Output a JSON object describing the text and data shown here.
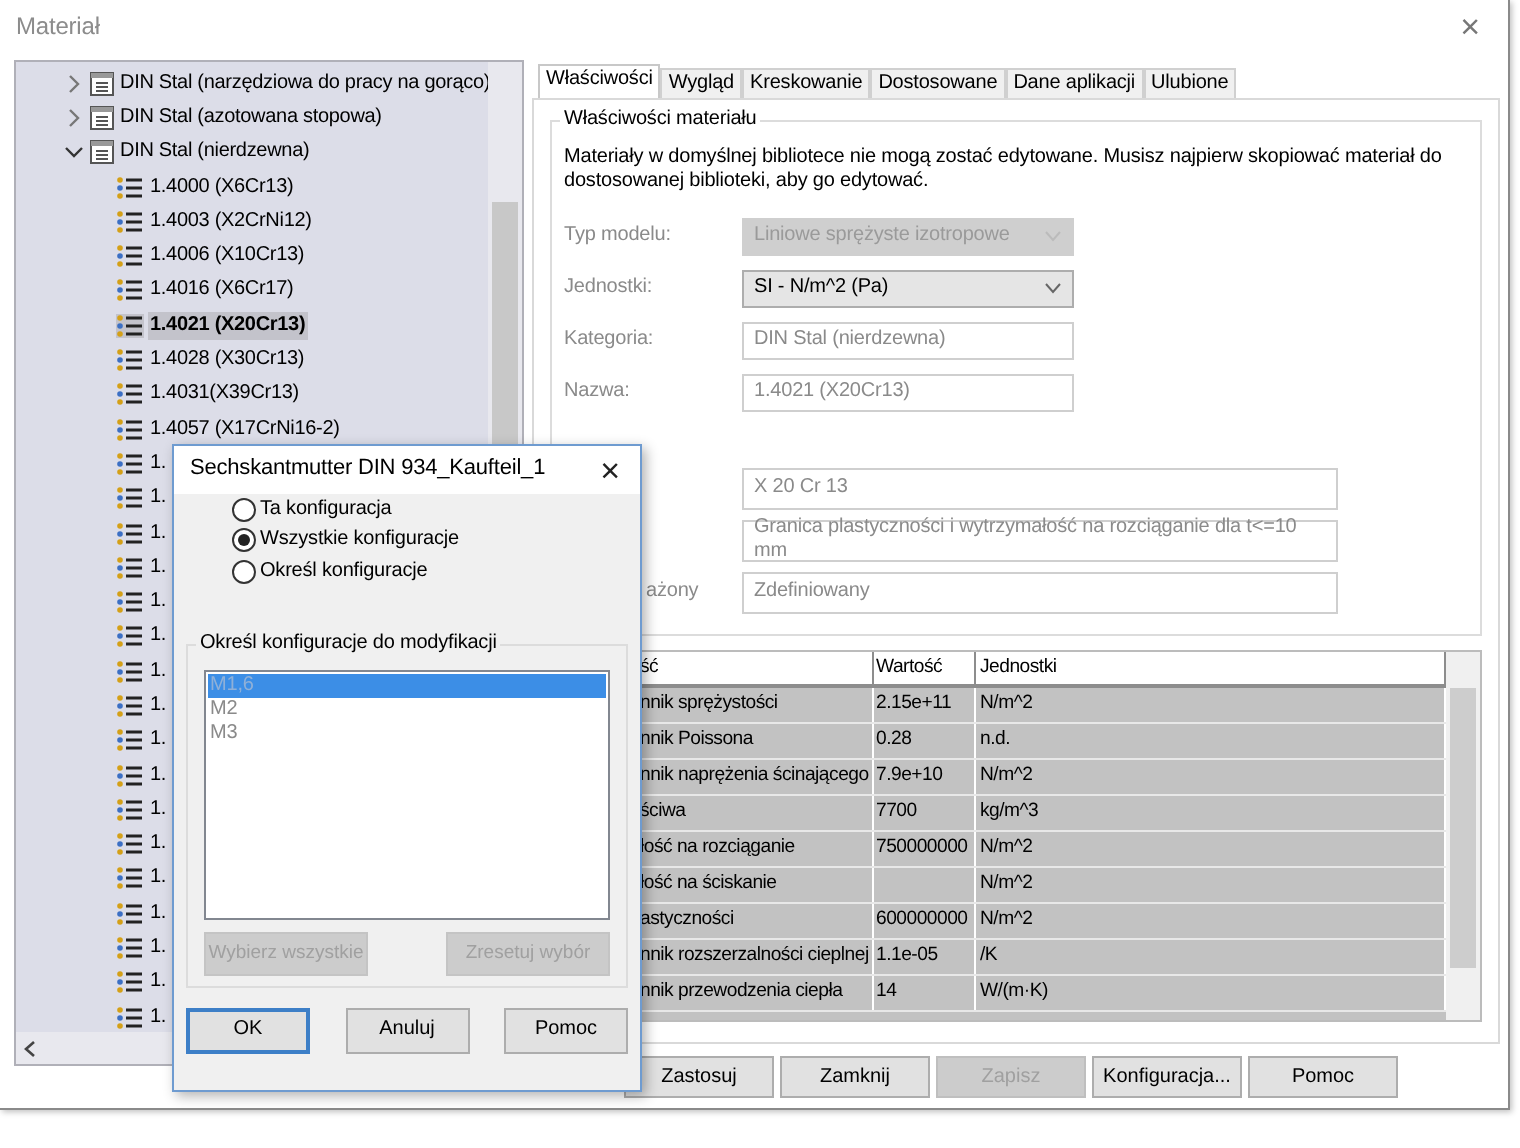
{
  "window": {
    "title": "Materiał",
    "close": "×"
  },
  "tree": {
    "items": [
      {
        "kind": "folder",
        "label": "DIN Stal (narzędziowa do pracy na gorąco)",
        "expanded": false,
        "selected": false
      },
      {
        "kind": "folder",
        "label": "DIN Stal (azotowana stopowa)",
        "expanded": false,
        "selected": false
      },
      {
        "kind": "folder",
        "label": "DIN Stal (nierdzewna)",
        "expanded": true,
        "selected": false,
        "children": [
          {
            "kind": "material",
            "label": "1.4000 (X6Cr13)",
            "selected": false
          },
          {
            "kind": "material",
            "label": "1.4003 (X2CrNi12)",
            "selected": false
          },
          {
            "kind": "material",
            "label": "1.4006 (X10Cr13)",
            "selected": false
          },
          {
            "kind": "material",
            "label": "1.4016 (X6Cr17)",
            "selected": false
          },
          {
            "kind": "material",
            "label": "1.4021 (X20Cr13)",
            "selected": true
          },
          {
            "kind": "material",
            "label": "1.4028 (X30Cr13)",
            "selected": false
          },
          {
            "kind": "material",
            "label": "1.4031(X39Cr13)",
            "selected": false
          },
          {
            "kind": "material",
            "label": "1.4057 (X17CrNi16-2)",
            "selected": false
          },
          {
            "kind": "material",
            "label": "1.",
            "selected": false
          },
          {
            "kind": "material",
            "label": "1.",
            "selected": false
          },
          {
            "kind": "material",
            "label": "1.",
            "selected": false
          },
          {
            "kind": "material",
            "label": "1.",
            "selected": false
          },
          {
            "kind": "material",
            "label": "1.",
            "selected": false
          },
          {
            "kind": "material",
            "label": "1.",
            "selected": false
          },
          {
            "kind": "material",
            "label": "1.",
            "selected": false
          },
          {
            "kind": "material",
            "label": "1.",
            "selected": false
          },
          {
            "kind": "material",
            "label": "1.",
            "selected": false
          },
          {
            "kind": "material",
            "label": "1.",
            "selected": false
          },
          {
            "kind": "material",
            "label": "1.",
            "selected": false
          },
          {
            "kind": "material",
            "label": "1.",
            "selected": false
          },
          {
            "kind": "material",
            "label": "1.",
            "selected": false
          },
          {
            "kind": "material",
            "label": "1.",
            "selected": false
          },
          {
            "kind": "material",
            "label": "1.",
            "selected": false
          },
          {
            "kind": "material",
            "label": "1.",
            "selected": false
          },
          {
            "kind": "material",
            "label": "1.",
            "selected": false
          }
        ]
      }
    ]
  },
  "tabs": [
    {
      "label": "Właściwości",
      "selected": true
    },
    {
      "label": "Wygląd",
      "selected": false
    },
    {
      "label": "Kreskowanie",
      "selected": false
    },
    {
      "label": "Dostosowane",
      "selected": false
    },
    {
      "label": "Dane aplikacji",
      "selected": false
    },
    {
      "label": "Ulubione",
      "selected": false
    }
  ],
  "properties": {
    "title": "Właściwości materiału",
    "note": "Materiały w domyślnej bibliotece nie mogą zostać edytowane. Musisz najpierw skopiować materiał do dostosowanej biblioteki, aby go edytować.",
    "fields": [
      {
        "kind": "select",
        "label": "Typ modelu:",
        "value": "Liniowe sprężyste izotropowe",
        "disabled": true
      },
      {
        "kind": "select",
        "label": "Jednostki:",
        "value": "SI - N/m^2 (Pa)",
        "disabled": false
      },
      {
        "kind": "text",
        "label": "Kategoria:",
        "value": "DIN Stal (nierdzewna)"
      },
      {
        "kind": "text",
        "label": "Nazwa:",
        "value": "1.4021 (X20Cr13)"
      }
    ],
    "extra_fields": [
      {
        "kind": "wide",
        "value": "X 20 Cr 13"
      },
      {
        "kind": "wide",
        "value": "Granica plastyczności i wytrzymałość na rozciąganie dla t<=10 mm"
      },
      {
        "kind": "wide",
        "label": "ażony",
        "value": "Zdefiniowany"
      }
    ]
  },
  "table": {
    "columns": [
      "ść",
      "Wartość",
      "Jednostki"
    ],
    "rows": [
      [
        "nnik sprężystości",
        "2.15e+11",
        "N/m^2"
      ],
      [
        "nnik Poissona",
        "0.28",
        "n.d."
      ],
      [
        "nnik naprężenia ścinającego",
        "7.9e+10",
        "N/m^2"
      ],
      [
        "ściwa",
        "7700",
        "kg/m^3"
      ],
      [
        "łość na rozciąganie",
        "750000000",
        "N/m^2"
      ],
      [
        "łość na ściskanie",
        null,
        "N/m^2"
      ],
      [
        "astyczności",
        "600000000",
        "N/m^2"
      ],
      [
        "nnik rozszerzalności cieplnej",
        "1.1e-05",
        "/K"
      ],
      [
        "nnik przewodzenia ciepła",
        "14",
        "W/(m·K)"
      ]
    ]
  },
  "buttons": [
    {
      "label": "Zastosuj",
      "disabled": false
    },
    {
      "label": "Zamknij",
      "disabled": false
    },
    {
      "label": "Zapisz",
      "disabled": true
    },
    {
      "label": "Konfiguracja...",
      "disabled": false
    },
    {
      "label": "Pomoc",
      "disabled": false
    }
  ],
  "dialog": {
    "title": "Sechskantmutter DIN 934_Kaufteil_1",
    "close": "×",
    "options": [
      {
        "label": "Ta konfiguracja",
        "selected": false
      },
      {
        "label": "Wszystkie konfiguracje",
        "selected": true
      },
      {
        "label": "Określ konfiguracje",
        "selected": false
      }
    ],
    "group_title": "Określ konfiguracje do modyfikacji",
    "configurations": [
      {
        "label": "M1,6",
        "selected": true
      },
      {
        "label": "M2",
        "selected": false
      },
      {
        "label": "M3",
        "selected": false
      }
    ],
    "list_buttons": [
      {
        "label": "Wybierz wszystkie",
        "disabled": true
      },
      {
        "label": "Zresetuj wybór",
        "disabled": true
      }
    ],
    "buttons": [
      {
        "label": "OK",
        "default": true
      },
      {
        "label": "Anuluj",
        "default": false
      },
      {
        "label": "Pomoc",
        "default": false
      }
    ]
  }
}
